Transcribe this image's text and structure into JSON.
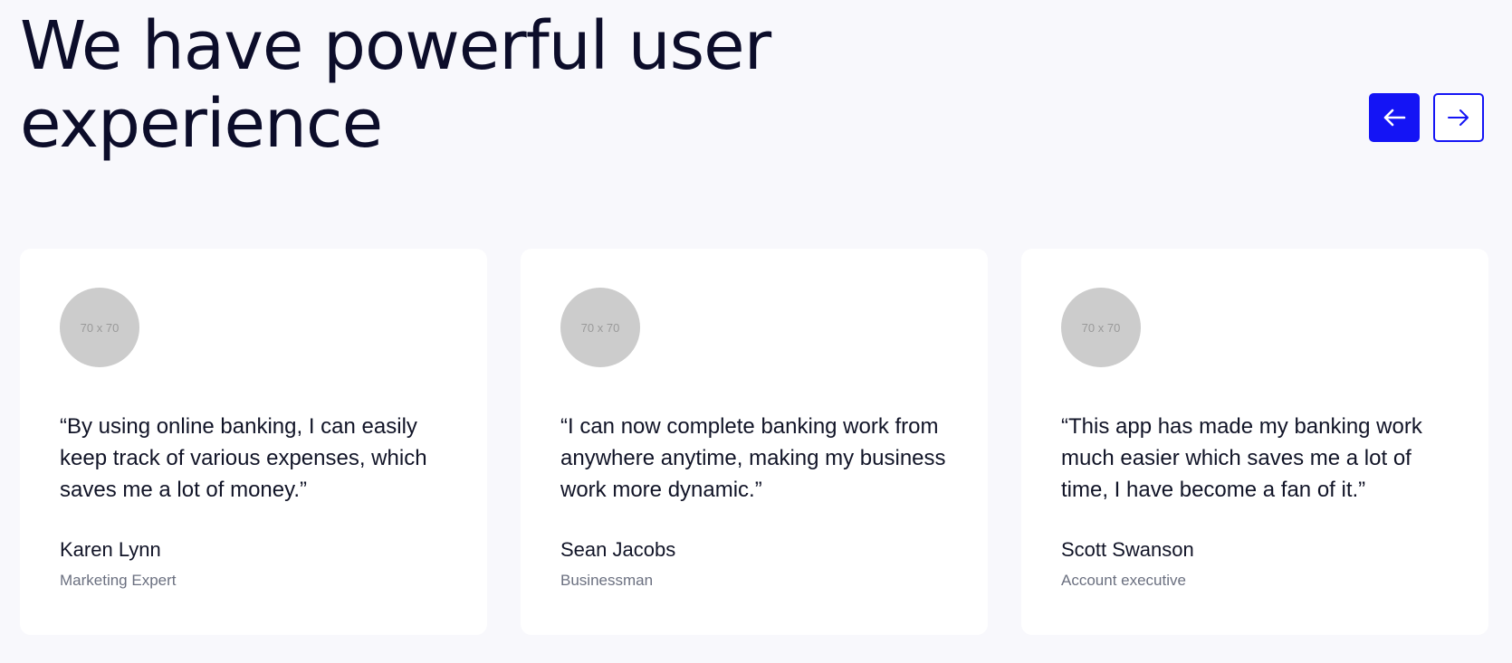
{
  "section": {
    "title_line1": "We have powerful user",
    "title_line2": "experience"
  },
  "navigation": {
    "prev_icon": "arrow-left-icon",
    "next_icon": "arrow-right-icon",
    "accent_color": "#1414f5"
  },
  "testimonials": [
    {
      "avatar_placeholder": "70 x 70",
      "quote": "“By using online banking, I can easily keep track of various expenses, which saves me a lot of money.”",
      "name": "Karen Lynn",
      "role": "Marketing Expert"
    },
    {
      "avatar_placeholder": "70 x 70",
      "quote": "“I can now complete banking work from anywhere anytime, making my business work more dynamic.”",
      "name": "Sean Jacobs",
      "role": "Businessman"
    },
    {
      "avatar_placeholder": "70 x 70",
      "quote": "“This app has made my banking work much easier which saves me a lot of time, I have become a fan of it.”",
      "name": "Scott Swanson",
      "role": "Account executive"
    }
  ]
}
